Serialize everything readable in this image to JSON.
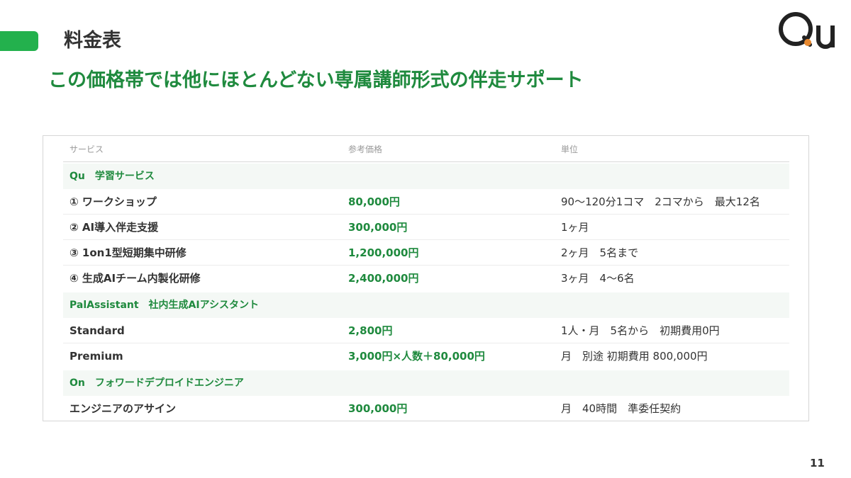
{
  "page_title": "料金表",
  "logo_text": "Qu",
  "headline": "この価格帯では他にほとんどない専属講師形式の伴走サポート",
  "table": {
    "headers": [
      "サービス",
      "参考価格",
      "単位"
    ],
    "sections": [
      {
        "title": "Qu　学習サービス",
        "rows": [
          {
            "service": "① ワークショップ",
            "price": "80,000円",
            "unit": "90〜120分1コマ　2コマから　最大12名"
          },
          {
            "service": "② AI導入伴走支援",
            "price": "300,000円",
            "unit": "1ヶ月"
          },
          {
            "service": "③ 1on1型短期集中研修",
            "price": "1,200,000円",
            "unit": "2ヶ月　5名まで"
          },
          {
            "service": "④ 生成AIチーム内製化研修",
            "price": "2,400,000円",
            "unit": "3ヶ月　4〜6名"
          }
        ]
      },
      {
        "title": "PalAssistant　社内生成AIアシスタント",
        "rows": [
          {
            "service": "Standard",
            "price": "2,800円",
            "unit": "1人・月　5名から　初期費用0円"
          },
          {
            "service": "Premium",
            "price": "3,000円×人数＋80,000円",
            "unit": "月　別途 初期費用 800,000円"
          }
        ]
      },
      {
        "title": "On　フォワードデプロイドエンジニア",
        "rows": [
          {
            "service": "エンジニアのアサイン",
            "price": "300,000円",
            "unit": "月　40時間　準委任契約"
          }
        ]
      }
    ]
  },
  "page_number": "11",
  "colors": {
    "brand_green": "#23b14d",
    "text_green": "#1f8a3e",
    "logo_dot": "#e8892f"
  }
}
